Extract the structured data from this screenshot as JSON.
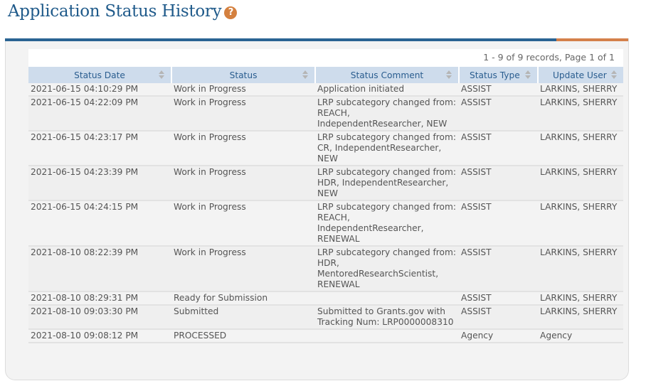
{
  "page": {
    "title": "Application Status History",
    "help_icon": "question-circle-icon",
    "help_glyph": "?"
  },
  "colors": {
    "title": "#1f5a8a",
    "primary_bar": "#2a6393",
    "accent_bar": "#d4804a",
    "header_bg": "#cedcec",
    "header_text": "#2a5d8f",
    "help_icon": "#d4803f"
  },
  "pager": {
    "summary": "1 - 9 of 9 records, Page 1 of 1"
  },
  "table": {
    "columns": [
      {
        "label": "Status Date",
        "sort_icon": "sort-icon"
      },
      {
        "label": "Status",
        "sort_icon": "sort-icon"
      },
      {
        "label": "Status Comment",
        "sort_icon": "sort-icon"
      },
      {
        "label": "Status Type",
        "sort_icon": "sort-icon"
      },
      {
        "label": "Update User",
        "sort_icon": "sort-icon"
      }
    ],
    "rows": [
      {
        "date": "2021-06-15 04:10:29 PM",
        "status": "Work in Progress",
        "comment": "Application initiated",
        "type": "ASSIST",
        "user": "LARKINS, SHERRY"
      },
      {
        "date": "2021-06-15 04:22:09 PM",
        "status": "Work in Progress",
        "comment": "LRP subcategory changed from: REACH, IndependentResearcher, NEW",
        "type": "ASSIST",
        "user": "LARKINS, SHERRY"
      },
      {
        "date": "2021-06-15 04:23:17 PM",
        "status": "Work in Progress",
        "comment": "LRP subcategory changed from: CR, IndependentResearcher, NEW",
        "type": "ASSIST",
        "user": "LARKINS, SHERRY"
      },
      {
        "date": "2021-06-15 04:23:39 PM",
        "status": "Work in Progress",
        "comment": "LRP subcategory changed from: HDR, IndependentResearcher, NEW",
        "type": "ASSIST",
        "user": "LARKINS, SHERRY"
      },
      {
        "date": "2021-06-15 04:24:15 PM",
        "status": "Work in Progress",
        "comment": "LRP subcategory changed from: REACH, IndependentResearcher, RENEWAL",
        "type": "ASSIST",
        "user": "LARKINS, SHERRY"
      },
      {
        "date": "2021-08-10 08:22:39 PM",
        "status": "Work in Progress",
        "comment": "LRP subcategory changed from: HDR, MentoredResearchScientist, RENEWAL",
        "type": "ASSIST",
        "user": "LARKINS, SHERRY"
      },
      {
        "date": "2021-08-10 08:29:31 PM",
        "status": "Ready for Submission",
        "comment": "",
        "type": "ASSIST",
        "user": "LARKINS, SHERRY"
      },
      {
        "date": "2021-08-10 09:03:30 PM",
        "status": "Submitted",
        "comment": "Submitted to Grants.gov with Tracking Num: LRP0000008310",
        "type": "ASSIST",
        "user": "LARKINS, SHERRY"
      },
      {
        "date": "2021-08-10 09:08:12 PM",
        "status": "PROCESSED",
        "comment": "",
        "type": "Agency",
        "user": "Agency"
      }
    ]
  }
}
